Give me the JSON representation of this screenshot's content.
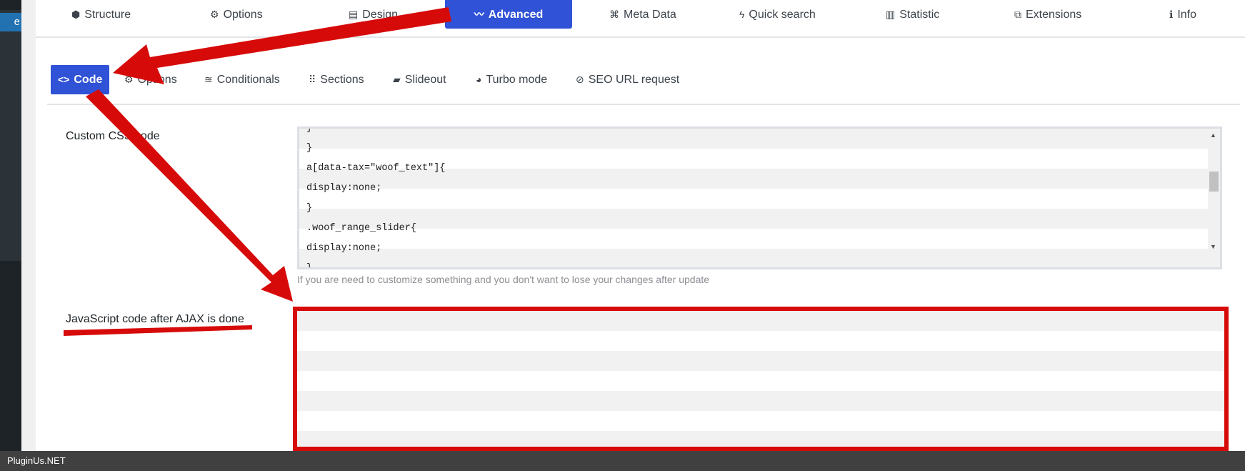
{
  "sidebar": {
    "current_item_fragment": "e"
  },
  "main_tabs": [
    {
      "label": "Structure",
      "icon": "cubes-icon",
      "glyph": "⬢"
    },
    {
      "label": "Options",
      "icon": "gear-icon",
      "glyph": "⚙"
    },
    {
      "label": "Design",
      "icon": "design-icon",
      "glyph": "▤"
    },
    {
      "label": "Advanced",
      "icon": "wave-icon",
      "glyph": "〰",
      "active": true
    },
    {
      "label": "Meta Data",
      "icon": "nodes-icon",
      "glyph": "⌘"
    },
    {
      "label": "Quick search",
      "icon": "bolt-icon",
      "glyph": "ϟ"
    },
    {
      "label": "Statistic",
      "icon": "bar-chart-icon",
      "glyph": "▥"
    },
    {
      "label": "Extensions",
      "icon": "puzzle-icon",
      "glyph": "⧉"
    },
    {
      "label": "Info",
      "icon": "info-icon",
      "glyph": "ℹ"
    }
  ],
  "sub_tabs": [
    {
      "label": "Code",
      "icon": "code-icon",
      "glyph": "<>",
      "active": true
    },
    {
      "label": "Options",
      "icon": "gear-icon",
      "glyph": "⚙"
    },
    {
      "label": "Conditionals",
      "icon": "approx-icon",
      "glyph": "≋"
    },
    {
      "label": "Sections",
      "icon": "grid-icon",
      "glyph": "⠿"
    },
    {
      "label": "Slideout",
      "icon": "truck-icon",
      "glyph": "▰"
    },
    {
      "label": "Turbo mode",
      "icon": "gauge-icon",
      "glyph": "◕"
    },
    {
      "label": "SEO URL request",
      "icon": "link-icon",
      "glyph": "⊘"
    }
  ],
  "css_field": {
    "label": "Custom CSS code",
    "lines": [
      "}",
      "}",
      "a[data-tax=\"woof_text\"]{",
      "display:none;",
      "}",
      ".woof_range_slider{",
      "display:none;",
      "}"
    ],
    "hint": "If you are need to customize something and you don't want to lose your changes after update"
  },
  "js_field": {
    "label": "JavaScript code after AJAX is done",
    "value": ""
  },
  "footer": {
    "brand": "PluginUs.NET"
  },
  "colors": {
    "accent": "#3052d6",
    "annotation": "#d70a0a"
  }
}
